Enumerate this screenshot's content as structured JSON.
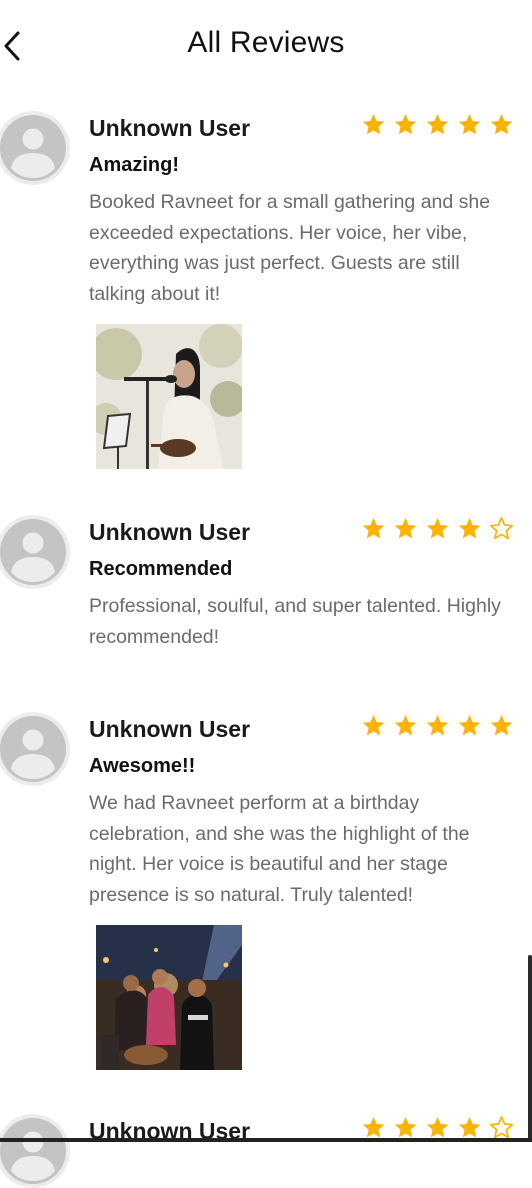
{
  "header": {
    "title": "All Reviews",
    "back_icon": "chevron-left-icon"
  },
  "colors": {
    "star": "#FFB300",
    "body_text": "#6b6b6b",
    "avatar_bg": "#ececec",
    "avatar_fg": "#c4c4c4"
  },
  "reviews": [
    {
      "user": "Unknown User",
      "rating": 5,
      "title": "Amazing!",
      "text": "Booked Ravneet for a small gathering and she exceeded expectations. Her voice, her vibe, everything was just perfect. Guests are still talking about it!",
      "has_photo": true
    },
    {
      "user": "Unknown User",
      "rating": 4,
      "title": "Recommended",
      "text": "Professional, soulful, and super talented. Highly recommended!",
      "has_photo": false
    },
    {
      "user": "Unknown User",
      "rating": 5,
      "title": "Awesome!!",
      "text": "We had Ravneet perform at a birthday celebration, and she was the highlight of the night. Her voice is beautiful and her stage presence is so natural. Truly talented!",
      "has_photo": true
    },
    {
      "user": "Unknown User",
      "rating": 4
    }
  ]
}
